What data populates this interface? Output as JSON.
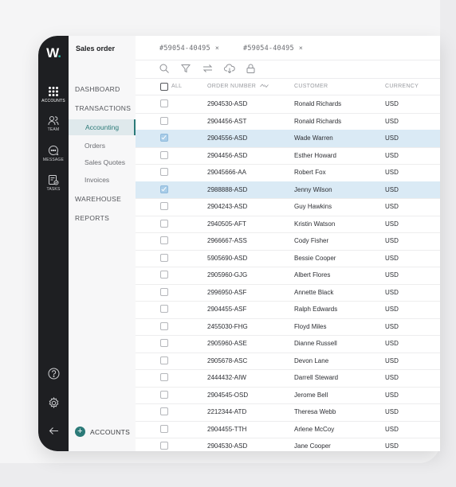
{
  "app": {
    "logo": "W",
    "logo_dot": "."
  },
  "rail": {
    "items": [
      {
        "label": "ACCOUNTS",
        "icon": "grid-icon",
        "active": true
      },
      {
        "label": "TEAM",
        "icon": "team-icon",
        "active": false
      },
      {
        "label": "MESSAGE",
        "icon": "message-icon",
        "active": false
      },
      {
        "label": "TASKS",
        "icon": "tasks-icon",
        "active": false
      }
    ],
    "bottom": [
      "help-icon",
      "settings-icon",
      "back-arrow-icon"
    ]
  },
  "nav": {
    "title": "Sales order",
    "dashboard": "DASHBOARD",
    "transactions": "TRANSACTIONS",
    "sub_items": [
      "Accounting",
      "Orders",
      "Sales Quotes",
      "Invoices"
    ],
    "warehouse": "WAREHOUSE",
    "reports": "REPORTS",
    "accounts_button": "ACCOUNTS",
    "accent": "#2b7a78"
  },
  "tabs": [
    {
      "label": "#59054-40495",
      "close": "×"
    },
    {
      "label": "#59054-40495",
      "close": "×"
    }
  ],
  "toolbar": [
    "search-icon",
    "filter-icon",
    "sync-icon",
    "cloud-download-icon",
    "lock-icon"
  ],
  "table": {
    "headers": {
      "all": "ALL",
      "order": "ORDER NUMBER",
      "customer": "CUSTOMER",
      "currency": "CURRENCY"
    },
    "rows": [
      {
        "order": "2904530-ASD",
        "customer": "Ronald Richards",
        "currency": "USD",
        "checked": false
      },
      {
        "order": "2904456-AST",
        "customer": "Ronald Richards",
        "currency": "USD",
        "checked": false
      },
      {
        "order": "2904556-ASD",
        "customer": "Wade Warren",
        "currency": "USD",
        "checked": true
      },
      {
        "order": "2904456-ASD",
        "customer": "Esther Howard",
        "currency": "USD",
        "checked": false
      },
      {
        "order": "29045666-AA",
        "customer": "Robert Fox",
        "currency": "USD",
        "checked": false
      },
      {
        "order": "2988888-ASD",
        "customer": "Jenny Wilson",
        "currency": "USD",
        "checked": true
      },
      {
        "order": "2904243-ASD",
        "customer": "Guy Hawkins",
        "currency": "USD",
        "checked": false
      },
      {
        "order": "2940505-AFT",
        "customer": "Kristin Watson",
        "currency": "USD",
        "checked": false
      },
      {
        "order": "2966667-ASS",
        "customer": "Cody Fisher",
        "currency": "USD",
        "checked": false
      },
      {
        "order": "5905690-ASD",
        "customer": "Bessie Cooper",
        "currency": "USD",
        "checked": false
      },
      {
        "order": "2905960-GJG",
        "customer": "Albert Flores",
        "currency": "USD",
        "checked": false
      },
      {
        "order": "2996950-ASF",
        "customer": "Annette Black",
        "currency": "USD",
        "checked": false
      },
      {
        "order": "2904455-ASF",
        "customer": "Ralph Edwards",
        "currency": "USD",
        "checked": false
      },
      {
        "order": "2455030-FHG",
        "customer": "Floyd Miles",
        "currency": "USD",
        "checked": false
      },
      {
        "order": "2905960-ASE",
        "customer": "Dianne Russell",
        "currency": "USD",
        "checked": false
      },
      {
        "order": "2905678-ASC",
        "customer": "Devon Lane",
        "currency": "USD",
        "checked": false
      },
      {
        "order": "2444432-AIW",
        "customer": "Darrell Steward",
        "currency": "USD",
        "checked": false
      },
      {
        "order": "2904545-OSD",
        "customer": "Jerome Bell",
        "currency": "USD",
        "checked": false
      },
      {
        "order": "2212344-ATD",
        "customer": "Theresa Webb",
        "currency": "USD",
        "checked": false
      },
      {
        "order": "2904455-TTH",
        "customer": "Arlene McCoy",
        "currency": "USD",
        "checked": false
      },
      {
        "order": "2904530-ASD",
        "customer": "Jane Cooper",
        "currency": "USD",
        "checked": false
      }
    ]
  }
}
